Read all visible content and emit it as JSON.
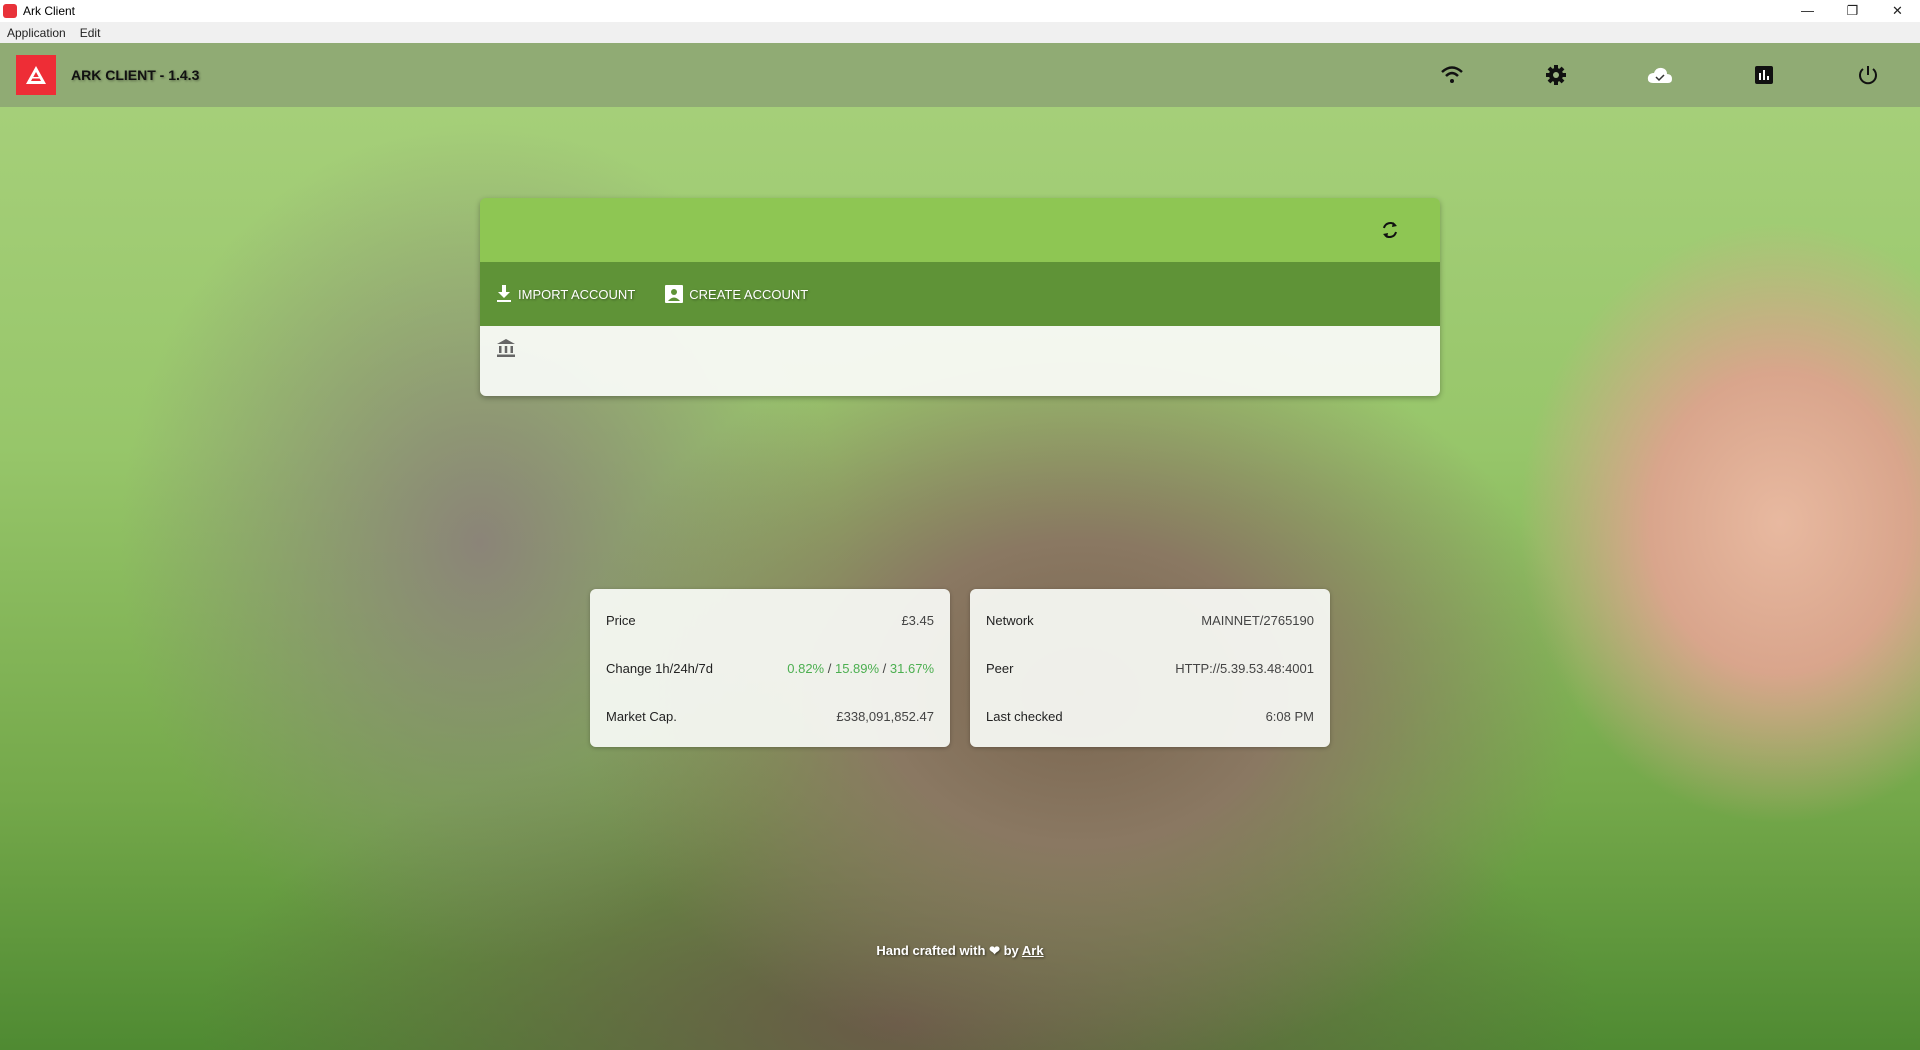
{
  "window": {
    "title": "Ark Client",
    "minimize": "—",
    "restore": "❐",
    "close": "✕"
  },
  "menu": [
    "Application",
    "Edit"
  ],
  "header": {
    "title": "ARK CLIENT - 1.4.3"
  },
  "actions": {
    "import": "IMPORT ACCOUNT",
    "create": "CREATE ACCOUNT"
  },
  "market": {
    "price_label": "Price",
    "price": "£3.45",
    "change_label": "Change 1h/24h/7d",
    "change_1h": "0.82%",
    "change_24h": "15.89%",
    "change_7d": "31.67%",
    "sep": " / ",
    "cap_label": "Market Cap.",
    "cap": "£338,091,852.47"
  },
  "network": {
    "network_label": "Network",
    "network": "MAINNET/2765190",
    "peer_label": "Peer",
    "peer": "HTTP://5.39.53.48:4001",
    "checked_label": "Last checked",
    "checked": "6:08 PM"
  },
  "footer": {
    "text": "Hand crafted with",
    "heart": "❤",
    "by": "by",
    "link": "Ark"
  }
}
